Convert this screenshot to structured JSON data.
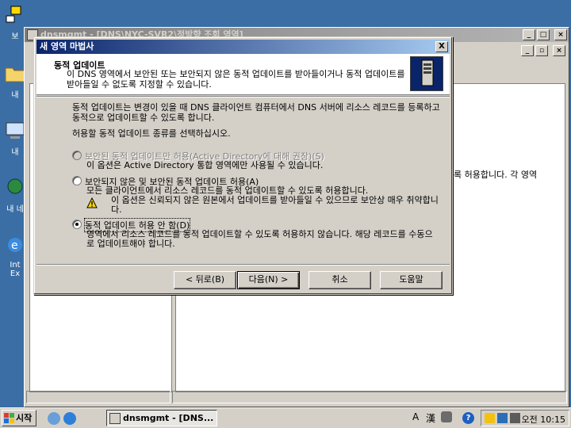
{
  "main_window": {
    "title": "dnsmgmt - [DNS\\NYC-SVR2\\정방향 조회 영역]",
    "right_pane_text": "록 허용합니다. 각 영역"
  },
  "desktop_icons": [
    "보",
    "내",
    "내 ",
    "내 네",
    "Int",
    "Ex"
  ],
  "wizard": {
    "title": "새 영역 마법사",
    "close_label": "X",
    "header_title": "동적 업데이트",
    "header_subtitle": "이 DNS 영역에서 보안된 또는 보안되지 않은 동적 업데이트를 받아들이거나 동적 업데이트를 받아들일 수 없도록 지정할 수 있습니다.",
    "intro": "동적 업데이트는 변경이 있을 때 DNS 클라이언트 컴퓨터에서 DNS 서버에 리소스 레코드를 등록하고 동적으로 업데이트할 수 있도록 합니다.",
    "prompt": "허용할 동적 업데이트 종류를 선택하십시오.",
    "options": [
      {
        "label": "보안된 동적 업데이트만 허용(Active Directory에 대해 권장)(S)",
        "desc": "이 옵션은 Active Directory 통합 영역에만 사용될 수 있습니다.",
        "disabled": true,
        "selected": false
      },
      {
        "label": "보안되지 않은 및 보안된 동적 업데이트 허용(A)",
        "desc": "모든 클라이언트에서 리소스 레코드를 동적 업데이트할 수 있도록 허용합니다.",
        "warning": "이 옵션은 신뢰되지 않은 원본에서 업데이트를 받아들일 수 있으므로 보안상 매우 취약합니다.",
        "disabled": false,
        "selected": false
      },
      {
        "label": "동적 업데이트 허용 안 함(D)",
        "desc": "영역에서 리소스 레코드를 동적 업데이트할 수 있도록 허용하지 않습니다. 해당 레코드를 수동으로 업데이트해야 합니다.",
        "disabled": false,
        "selected": true
      }
    ],
    "buttons": {
      "back": "< 뒤로(B)",
      "next": "다음(N) >",
      "cancel": "취소",
      "help": "도움말"
    }
  },
  "taskbar": {
    "start_label": "시작",
    "task_label": "dnsmgmt - [DNS...",
    "ime_a": "A",
    "ime_han": "漢",
    "clock": "오전 10:15"
  },
  "colors": {
    "desktop": "#3a6ea5",
    "active_title": "#0a246a",
    "inactive_title": "#808080",
    "face": "#d4d0c8"
  }
}
